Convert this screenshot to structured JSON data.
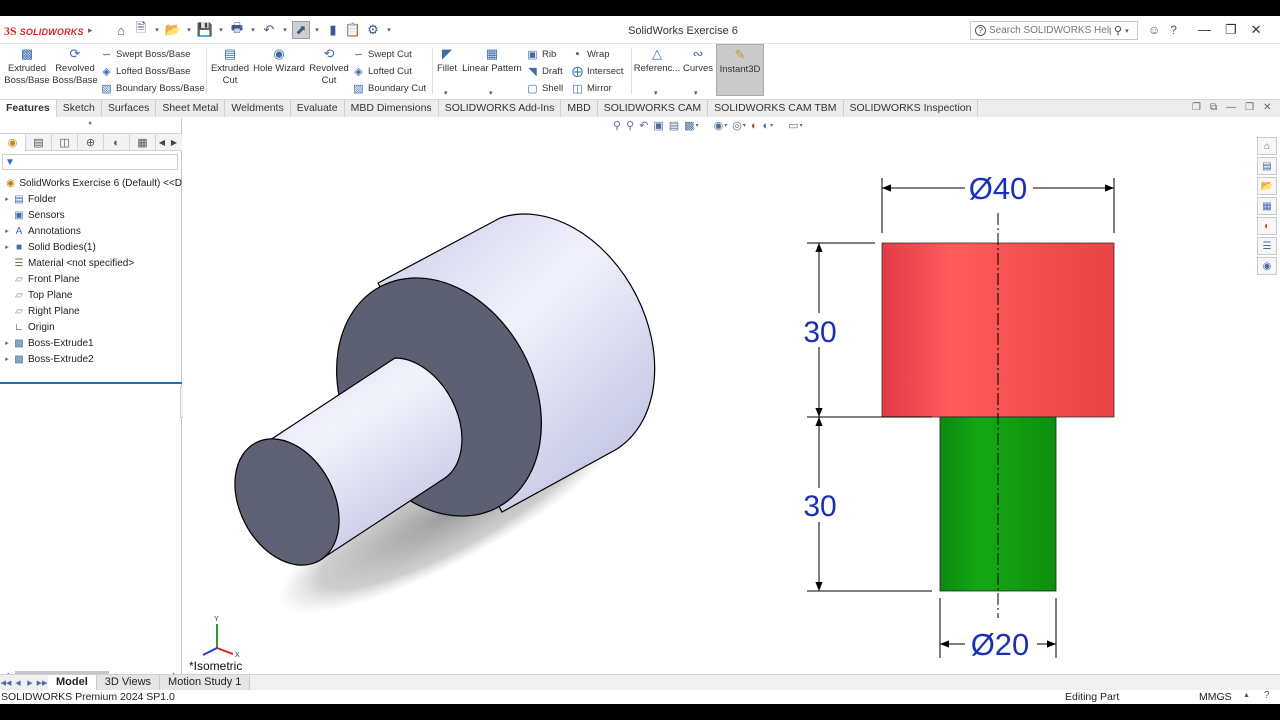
{
  "app": {
    "logo_mark": "3S",
    "logo_text": "SOLIDWORKS",
    "document_title": "SolidWorks Exercise 6",
    "search_placeholder": "Search SOLIDWORKS Help"
  },
  "ribbon": {
    "extruded_boss": "Extruded Boss/Base",
    "revolved_boss": "Revolved Boss/Base",
    "swept_boss": "Swept Boss/Base",
    "lofted_boss": "Lofted Boss/Base",
    "boundary_boss": "Boundary Boss/Base",
    "extruded_cut": "Extruded Cut",
    "hole_wizard": "Hole Wizard",
    "revolved_cut": "Revolved Cut",
    "swept_cut": "Swept Cut",
    "lofted_cut": "Lofted Cut",
    "boundary_cut": "Boundary Cut",
    "fillet": "Fillet",
    "linear_pattern": "Linear Pattern",
    "rib": "Rib",
    "draft": "Draft",
    "shell": "Shell",
    "wrap": "Wrap",
    "intersect": "Intersect",
    "mirror": "Mirror",
    "reference": "Referenc...",
    "curves": "Curves",
    "instant3d": "Instant3D"
  },
  "command_tabs": [
    "Features",
    "Sketch",
    "Surfaces",
    "Sheet Metal",
    "Weldments",
    "Evaluate",
    "MBD Dimensions",
    "SOLIDWORKS Add-Ins",
    "MBD",
    "SOLIDWORKS CAM",
    "SOLIDWORKS CAM TBM",
    "SOLIDWORKS Inspection"
  ],
  "active_command_tab": "Features",
  "feature_tree": {
    "root": "SolidWorks Exercise 6 (Default) <<D",
    "items": [
      {
        "label": "Folder"
      },
      {
        "label": "Sensors"
      },
      {
        "label": "Annotations"
      },
      {
        "label": "Solid Bodies(1)"
      },
      {
        "label": "Material <not specified>"
      },
      {
        "label": "Front Plane"
      },
      {
        "label": "Top Plane"
      },
      {
        "label": "Right Plane"
      },
      {
        "label": "Origin"
      },
      {
        "label": "Boss-Extrude1"
      },
      {
        "label": "Boss-Extrude2"
      }
    ]
  },
  "viewport": {
    "view_name": "*Isometric",
    "triad": {
      "y": "Y",
      "x": "X"
    }
  },
  "drawing": {
    "top_diameter": "Ø40",
    "bottom_diameter": "Ø20",
    "top_height": "30",
    "bottom_height": "30",
    "top_color": "#f24a4a",
    "bottom_color": "#10a010",
    "dimension_color": "#1a2fb8"
  },
  "bottom_tabs": [
    "Model",
    "3D Views",
    "Motion Study 1"
  ],
  "active_bottom_tab": "Model",
  "status": {
    "product": "SOLIDWORKS Premium 2024 SP1.0",
    "mode": "Editing Part",
    "units": "MMGS"
  }
}
